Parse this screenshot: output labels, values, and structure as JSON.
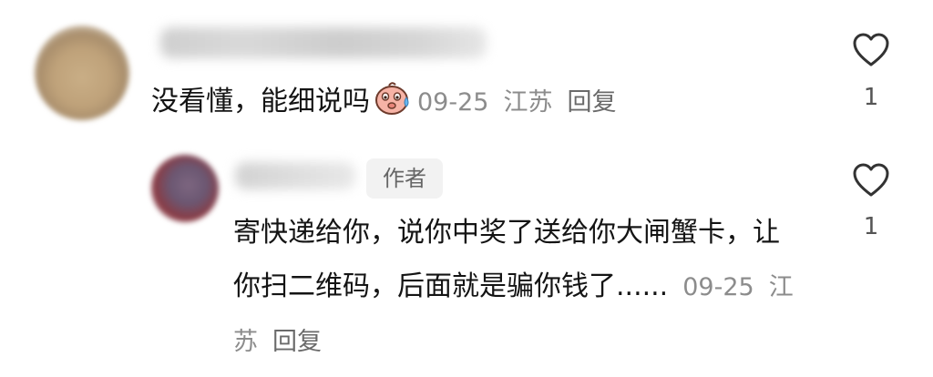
{
  "comments": [
    {
      "text": "没看懂，能细说吗",
      "emoji": "cold-sweat-face-emoji",
      "date": "09-25",
      "location": "江苏",
      "reply_label": "回复",
      "like_count": "1"
    },
    {
      "author_tag": "作者",
      "text": "寄快递给你，说你中奖了送给你大闸蟹卡，让你扫二维码，后面就是骗你钱了......",
      "date": "09-25",
      "location": "江苏",
      "reply_label": "回复",
      "like_count": "1"
    }
  ],
  "icons": {
    "like": "heart-outline-icon"
  },
  "colors": {
    "text": "#141414",
    "meta": "#8c8c8c",
    "author_tag_bg": "#f2f2f2"
  }
}
